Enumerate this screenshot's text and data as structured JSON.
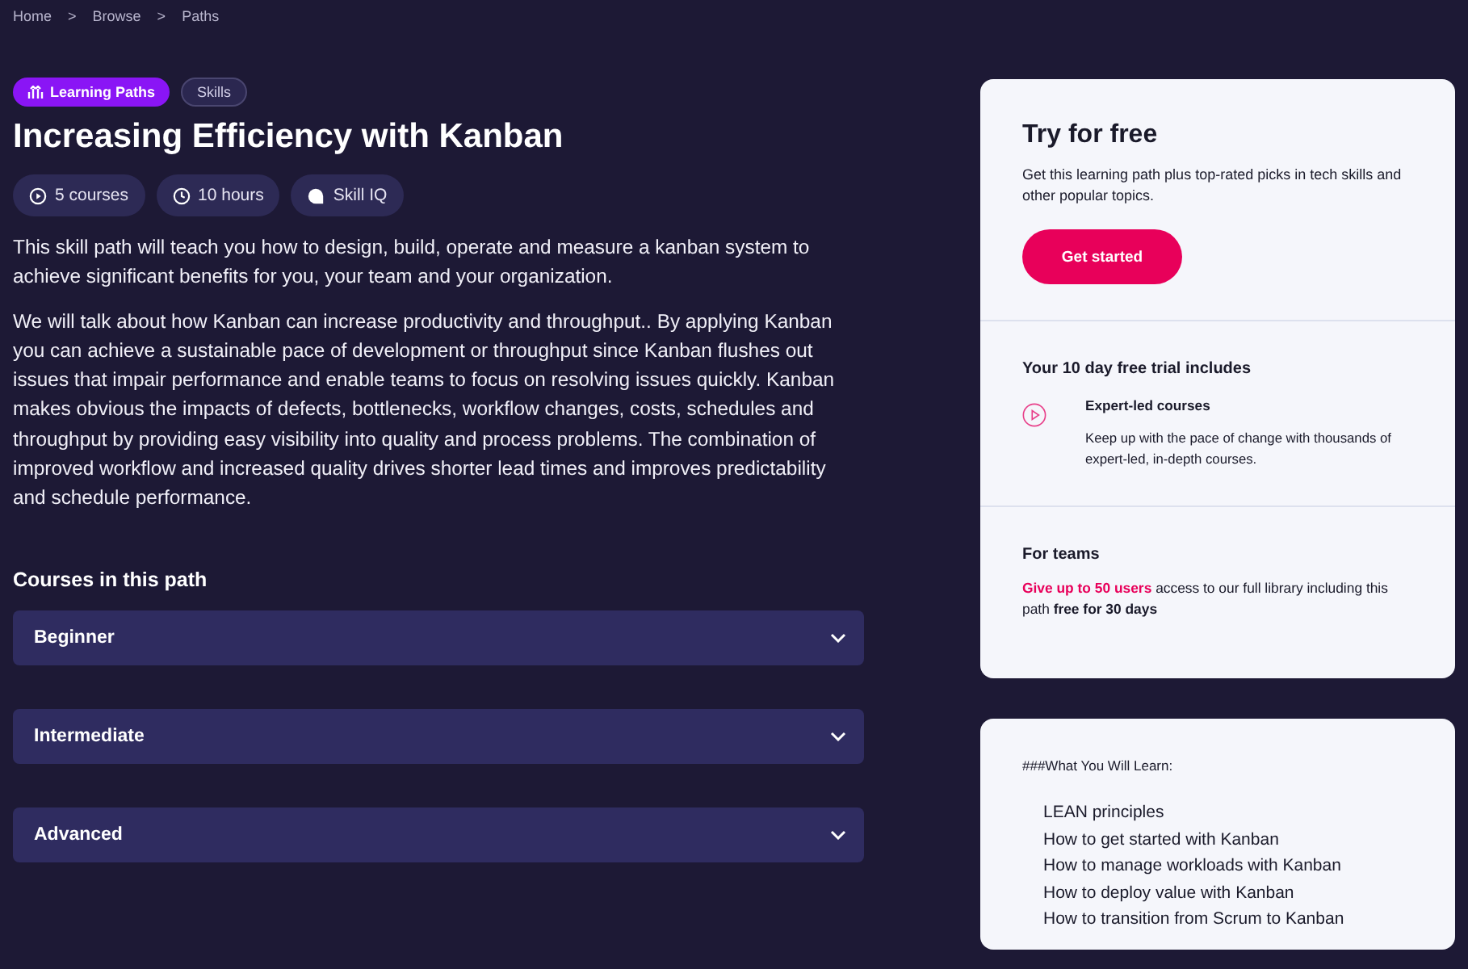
{
  "breadcrumbs": [
    "Home",
    "Browse",
    "Paths"
  ],
  "breadcrumb_separator": ">",
  "tags": [
    {
      "label": "Learning Paths",
      "kind": "primary"
    },
    {
      "label": "Skills",
      "kind": "secondary"
    }
  ],
  "title": "Increasing Efficiency with Kanban",
  "stats": [
    {
      "label": "5 courses",
      "kind": "play"
    },
    {
      "label": "10 hours",
      "kind": "clock"
    },
    {
      "label": "Skill IQ",
      "kind": "skilliq"
    }
  ],
  "description": [
    "This skill path will teach you how to design, build, operate and measure a kanban system to achieve significant benefits for you, your team and your organization.",
    "We will talk about how Kanban can increase productivity and throughput.. By applying Kanban you can achieve a sustainable pace of development or throughput since Kanban flushes out issues that impair performance and enable teams to focus on resolving issues quickly. Kanban makes obvious the impacts of defects, bottlenecks, workflow changes, costs, schedules and throughput by providing easy visibility into quality and process problems. The combination of improved workflow and increased quality drives shorter lead times and improves predictability and schedule performance."
  ],
  "courses_heading": "Courses in this path",
  "levels": [
    {
      "label": "Beginner",
      "expanded": false
    },
    {
      "label": "Intermediate",
      "expanded": false
    },
    {
      "label": "Advanced",
      "expanded": false
    }
  ],
  "trial_card": {
    "title": "Try for free",
    "text": "Get this learning path plus top-rated picks in tech skills and other popular topics.",
    "button": "Get started",
    "includes_heading": "Your 10 day free trial includes",
    "feature": {
      "title": "Expert-led courses",
      "text": "Keep up with the pace of change with thousands of expert-led, in-depth courses."
    },
    "teams_heading": "For teams",
    "teams_text": "**Give up to 50 users** access to our full library including this path **free for 30 days**"
  },
  "learn_card": {
    "heading": "###What You Will Learn:",
    "items": [
      "LEAN principles",
      "How to get started with Kanban",
      "How to manage workloads with Kanban",
      "How to deploy value with Kanban",
      "How to transition from Scrum to Kanban"
    ]
  }
}
